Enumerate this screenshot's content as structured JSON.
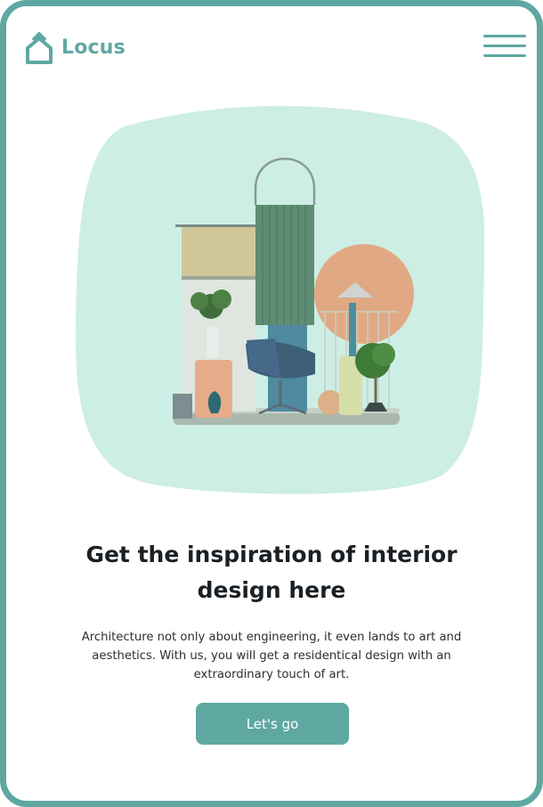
{
  "brand": {
    "name": "Locus",
    "color": "#5fa8a2",
    "icon": "house-outline-icon"
  },
  "nav": {
    "menu_icon": "hamburger-menu-icon"
  },
  "hero": {
    "illustration": "interior-design-collage",
    "blob_color": "#cdeee4"
  },
  "content": {
    "title": "Get the inspiration of interior design here",
    "description": "Architecture not only about engineering, it even lands to art and aesthetics. With us, you will get a residentical design with an extraordinary touch of art.",
    "cta_label": "Let's go"
  },
  "colors": {
    "accent": "#5fa8a2",
    "heading": "#1b2024",
    "text": "#2b2f33"
  }
}
